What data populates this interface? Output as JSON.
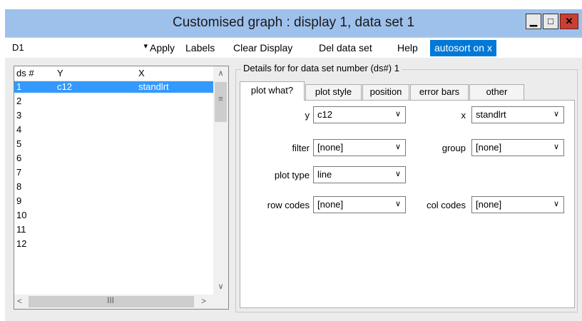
{
  "window": {
    "title": "Customised graph : display 1, data set 1"
  },
  "controls": {
    "minimize_glyph": "▁",
    "maximize_glyph": "□",
    "close_glyph": "✕"
  },
  "menubar": {
    "selector_value": "D1",
    "items": [
      "Apply",
      "Labels",
      "Clear Display",
      "Del data set",
      "Help"
    ],
    "toggle": "autosort on x"
  },
  "dataset_list": {
    "columns": [
      "ds #",
      "Y",
      "X"
    ],
    "rows": [
      {
        "ds": "1",
        "y": "c12",
        "x": "standlrt",
        "selected": true
      },
      {
        "ds": "2",
        "y": "",
        "x": ""
      },
      {
        "ds": "3",
        "y": "",
        "x": ""
      },
      {
        "ds": "4",
        "y": "",
        "x": ""
      },
      {
        "ds": "5",
        "y": "",
        "x": ""
      },
      {
        "ds": "6",
        "y": "",
        "x": ""
      },
      {
        "ds": "7",
        "y": "",
        "x": ""
      },
      {
        "ds": "8",
        "y": "",
        "x": ""
      },
      {
        "ds": "9",
        "y": "",
        "x": ""
      },
      {
        "ds": "10",
        "y": "",
        "x": ""
      },
      {
        "ds": "11",
        "y": "",
        "x": ""
      },
      {
        "ds": "12",
        "y": "",
        "x": ""
      }
    ]
  },
  "details": {
    "legend": "Details for for data set number (ds#) 1",
    "tabs": [
      "plot what?",
      "plot style",
      "position",
      "error bars",
      "other"
    ],
    "fields": {
      "y": {
        "label": "y",
        "value": "c12"
      },
      "x": {
        "label": "x",
        "value": "standlrt"
      },
      "filter": {
        "label": "filter",
        "value": "[none]"
      },
      "group": {
        "label": "group",
        "value": "[none]"
      },
      "plot_type": {
        "label": "plot type",
        "value": "line"
      },
      "row_codes": {
        "label": "row codes",
        "value": "[none]"
      },
      "col_codes": {
        "label": "col codes",
        "value": "[none]"
      }
    }
  },
  "colors": {
    "title_bar": "#9ec1ec",
    "selection": "#3399ff",
    "toggle_active": "#0078d7",
    "close_button": "#c84031"
  }
}
